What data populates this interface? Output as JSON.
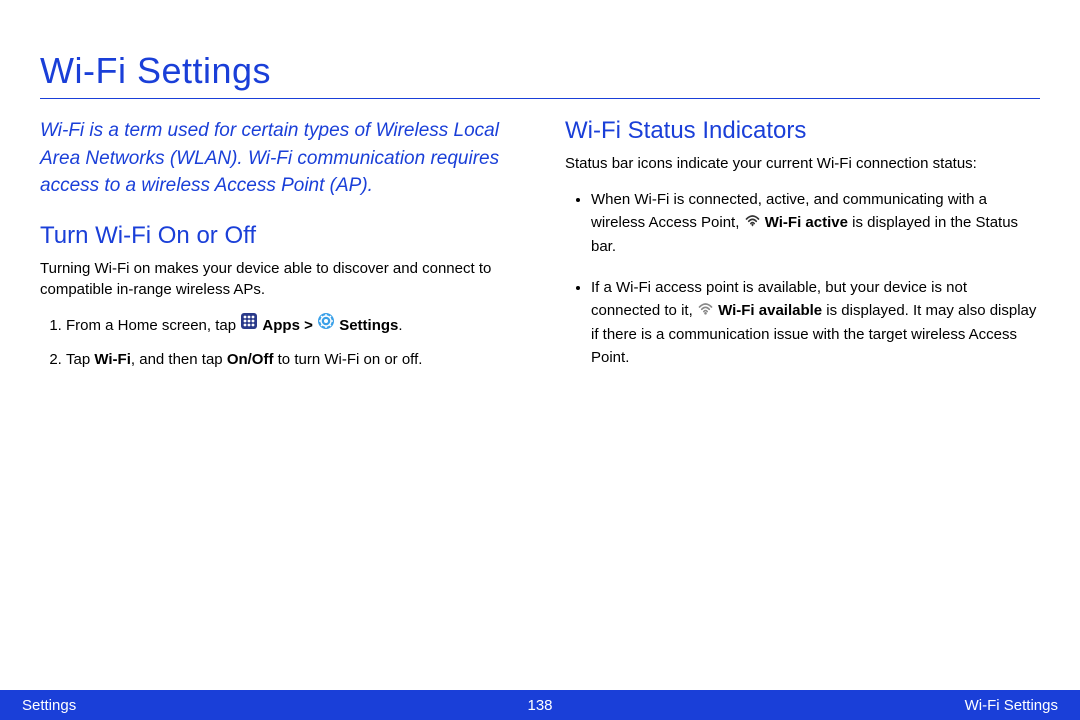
{
  "title": "Wi-Fi Settings",
  "intro": "Wi-Fi is a term used for certain types of Wireless Local Area Networks (WLAN). Wi-Fi communication requires access to a wireless Access Point (AP).",
  "left": {
    "heading": "Turn Wi-Fi On or Off",
    "desc": "Turning Wi-Fi on makes your device able to discover and connect to compatible in-range wireless APs.",
    "step1_prefix": "From a Home screen, tap ",
    "apps_label": "Apps",
    "gt": " > ",
    "settings_label": "Settings",
    "step1_suffix": ".",
    "step2_a": "Tap ",
    "step2_wifi": "Wi-Fi",
    "step2_b": ", and then tap ",
    "step2_onoff": "On/Off",
    "step2_c": " to turn Wi-Fi on or off."
  },
  "right": {
    "heading": "Wi-Fi Status Indicators",
    "desc": "Status bar icons indicate your current Wi-Fi connection status:",
    "b1_a": "When Wi-Fi is connected, active, and communicating with a wireless Access Point, ",
    "b1_bold": "Wi-Fi active",
    "b1_b": " is displayed in the Status bar.",
    "b2_a": "If a Wi-Fi access point is available, but your device is not connected to it, ",
    "b2_bold": "Wi-Fi available",
    "b2_b": " is displayed. It may also display if there is a communication issue with the target wireless Access Point."
  },
  "footer": {
    "left": "Settings",
    "center": "138",
    "right": "Wi-Fi Settings"
  }
}
